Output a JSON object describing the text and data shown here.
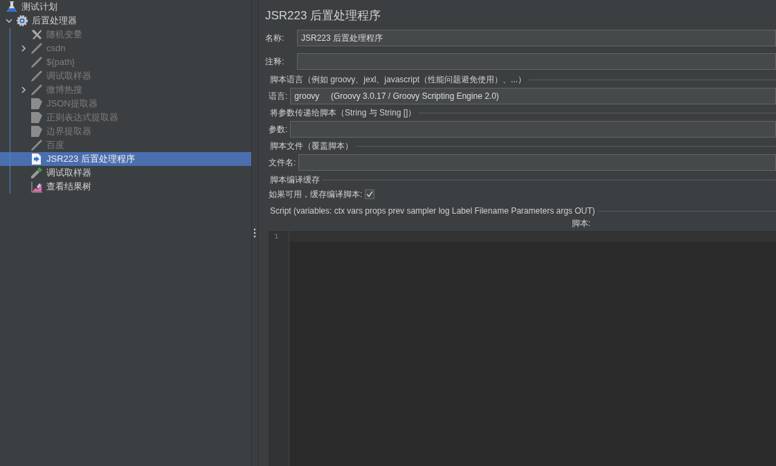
{
  "tree": {
    "label": "测试计划",
    "kind": "flask",
    "children": [
      {
        "label": "后置处理器",
        "kind": "gear",
        "expanded": true,
        "disabled": false,
        "selected": false,
        "children": [
          {
            "label": "随机变量",
            "kind": "tools",
            "disabled": true,
            "selected": false
          },
          {
            "label": "csdn",
            "kind": "pen",
            "disabled": true,
            "selected": false,
            "expanded": false
          },
          {
            "label": "${path}",
            "kind": "pen",
            "disabled": true,
            "selected": false
          },
          {
            "label": "调试取样器",
            "kind": "pen",
            "disabled": true,
            "selected": false
          },
          {
            "label": "微博热搜",
            "kind": "pen",
            "disabled": true,
            "selected": false,
            "expanded": false
          },
          {
            "label": "JSON提取器",
            "kind": "page",
            "disabled": true,
            "selected": false
          },
          {
            "label": "正则表达式提取器",
            "kind": "page",
            "disabled": true,
            "selected": false
          },
          {
            "label": "边界提取器",
            "kind": "page",
            "disabled": true,
            "selected": false
          },
          {
            "label": "百度",
            "kind": "pen",
            "disabled": true,
            "selected": false
          },
          {
            "label": "JSR223 后置处理程序",
            "kind": "script",
            "disabled": false,
            "selected": true
          },
          {
            "label": "调试取样器",
            "kind": "pipette",
            "disabled": false,
            "selected": false
          },
          {
            "label": "查看结果树",
            "kind": "chart",
            "disabled": false,
            "selected": false
          }
        ]
      }
    ]
  },
  "panel": {
    "title": "JSR223 后置处理程序",
    "name": {
      "label": "名称:",
      "value": "JSR223 后置处理程序"
    },
    "comment": {
      "label": "注释:"
    },
    "language_group": {
      "title": "脚本语言（例如 groovy、jexl、javascript（性能问题避免使用）、...）",
      "label": "语言:",
      "value": "groovy     (Groovy 3.0.17 / Groovy Scripting Engine 2.0)"
    },
    "params_group": {
      "title": "将参数传递给脚本（String 与 String []）",
      "label": "参数:"
    },
    "file_group": {
      "title": "脚本文件（覆盖脚本）",
      "label": "文件名:"
    },
    "cache_group": {
      "title": "脚本编译缓存",
      "label": "如果可用，缓存编译脚本:",
      "checked": true
    },
    "script_group": {
      "title": "Script (variables: ctx vars props prev sampler log Label Filename Parameters args OUT)",
      "label": "脚本:",
      "line_numbers": [
        "1"
      ]
    }
  }
}
